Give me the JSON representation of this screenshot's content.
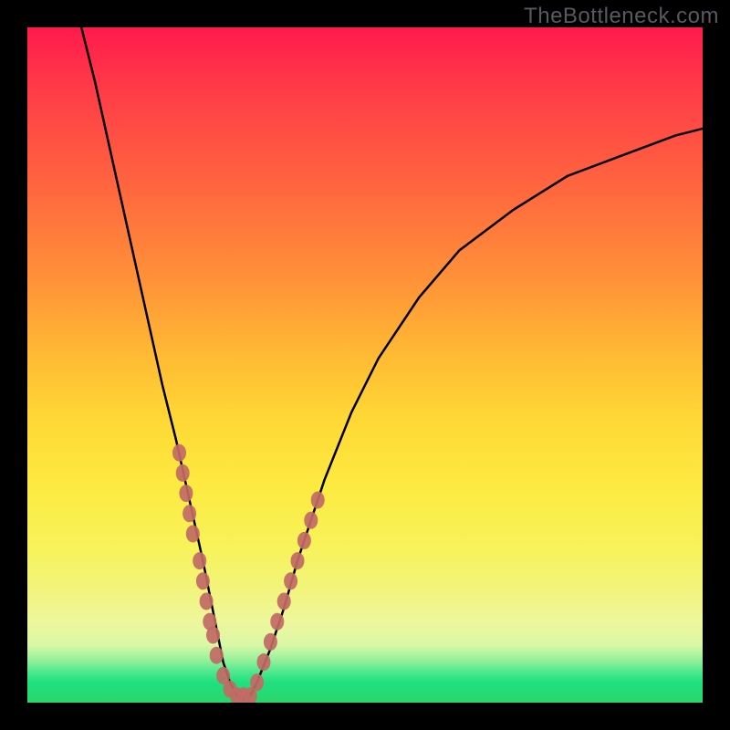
{
  "watermark": {
    "text": "TheBottleneck.com"
  },
  "colors": {
    "frame": "#000000",
    "curve": "#000000",
    "dots": "#c26b65",
    "gradient_top": "#ff1a4d",
    "gradient_bottom": "#2bd66a"
  },
  "chart_data": {
    "type": "line",
    "title": "",
    "xlabel": "",
    "ylabel": "",
    "xlim": [
      0,
      100
    ],
    "ylim": [
      0,
      100
    ],
    "grid": false,
    "note": "No axes, ticks, or labels are rendered in the image. Values below are pixel-estimated as percentages of the plot area (0–100 each axis, 0,0 at bottom-left).",
    "series": [
      {
        "name": "bottleneck-curve",
        "x": [
          8,
          10,
          12,
          14,
          16,
          18,
          20,
          22,
          24,
          26,
          27,
          28,
          29,
          30,
          31,
          32,
          33,
          34,
          36,
          38,
          40,
          44,
          48,
          52,
          58,
          64,
          72,
          80,
          88,
          96,
          100
        ],
        "y": [
          100,
          92,
          83,
          74,
          65,
          56,
          47,
          39,
          30,
          21,
          16,
          11,
          6,
          3,
          1,
          0.5,
          1,
          3,
          8,
          14,
          21,
          33,
          43,
          51,
          60,
          67,
          73,
          78,
          81,
          84,
          85
        ]
      }
    ],
    "highlight_points": {
      "name": "marker-dots",
      "note": "Salmon-colored dots clustered along both arms near the trough.",
      "points": [
        {
          "x": 22.5,
          "y": 37
        },
        {
          "x": 23.0,
          "y": 34
        },
        {
          "x": 23.5,
          "y": 31
        },
        {
          "x": 24.0,
          "y": 28
        },
        {
          "x": 24.5,
          "y": 25
        },
        {
          "x": 25.5,
          "y": 21
        },
        {
          "x": 26.0,
          "y": 18
        },
        {
          "x": 26.5,
          "y": 15
        },
        {
          "x": 27.0,
          "y": 12
        },
        {
          "x": 27.5,
          "y": 10
        },
        {
          "x": 28.0,
          "y": 7
        },
        {
          "x": 29.0,
          "y": 4
        },
        {
          "x": 30.0,
          "y": 2
        },
        {
          "x": 31.0,
          "y": 1
        },
        {
          "x": 32.0,
          "y": 1
        },
        {
          "x": 33.0,
          "y": 1
        },
        {
          "x": 34.0,
          "y": 3
        },
        {
          "x": 35.0,
          "y": 6
        },
        {
          "x": 36.0,
          "y": 9
        },
        {
          "x": 37.0,
          "y": 12
        },
        {
          "x": 38.0,
          "y": 15
        },
        {
          "x": 39.0,
          "y": 18
        },
        {
          "x": 40.0,
          "y": 21
        },
        {
          "x": 41.0,
          "y": 24
        },
        {
          "x": 42.0,
          "y": 27
        },
        {
          "x": 43.0,
          "y": 30
        }
      ]
    }
  }
}
